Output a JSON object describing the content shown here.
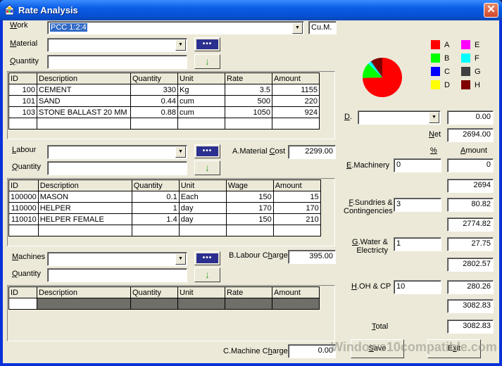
{
  "window": {
    "title": "Rate Analysis",
    "close_label": "✕"
  },
  "work": {
    "label_u": "W",
    "label_rest": "ork",
    "value": "PCC 1:2:4",
    "unit": "Cu.M."
  },
  "material": {
    "label_u": "M",
    "label_rest": "aterial",
    "value": "",
    "quantity_label_u": "Q",
    "quantity_label_rest": "uantity",
    "quantity_value": "",
    "browse_label": "•••",
    "add_icon": "↓",
    "columns": [
      "ID",
      "Description",
      "Quantity",
      "Unit",
      "Rate",
      "Amount"
    ],
    "rows": [
      [
        "100",
        "CEMENT",
        "330",
        "Kg",
        "3.5",
        "1155"
      ],
      [
        "101",
        "SAND",
        "0.44",
        "cum",
        "500",
        "220"
      ],
      [
        "103",
        "STONE BALLAST 20 MM",
        "0.88",
        "cum",
        "1050",
        "924"
      ]
    ]
  },
  "labour": {
    "label_u": "L",
    "label_rest": "abour",
    "value": "",
    "quantity_label_u": "Q",
    "quantity_label_rest": "uantity",
    "quantity_value": "",
    "browse_label": "•••",
    "add_icon": "↓",
    "columns": [
      "ID",
      "Description",
      "Quantity",
      "Unit",
      "Wage",
      "Amount"
    ],
    "rows": [
      [
        "100000",
        "MASON",
        "0.1",
        "Each",
        "150",
        "15"
      ],
      [
        "110000",
        "HELPER",
        "1",
        "day",
        "170",
        "170"
      ],
      [
        "110010",
        "HELPER FEMALE",
        "1.4",
        "day",
        "150",
        "210"
      ]
    ]
  },
  "machines": {
    "label_u": "M",
    "label_rest": "achines",
    "value": "",
    "quantity_label_u": "Q",
    "quantity_label_rest": "uantity",
    "quantity_value": "",
    "browse_label": "•••",
    "add_icon": "↓",
    "columns": [
      "ID",
      "Description",
      "Quantity",
      "Unit",
      "Rate",
      "Amount"
    ],
    "rows": []
  },
  "totals": {
    "material_cost_label_a": "A.Material ",
    "material_cost_label_u": "C",
    "material_cost_label_b": "ost",
    "material_cost": "2299.00",
    "labour_charge_label_a": "B.Labour C",
    "labour_charge_label_u": "h",
    "labour_charge_label_b": "arge",
    "labour_charge": "395.00",
    "machine_charge_label_a": "C.Machine C",
    "machine_charge_label_u": "h",
    "machine_charge_label_b": "arge",
    "machine_charge": "0.00"
  },
  "summary": {
    "d_label_u": "D",
    "d_label_rest": ".",
    "d_value": "",
    "d_amount": "0.00",
    "net_label_u": "N",
    "net_label_rest": "et",
    "net": "2694.00",
    "pct_header": "%",
    "amount_header_u": "A",
    "amount_header_rest": "mount",
    "machinery": {
      "label_u": "E",
      "label_rest": ".Machinery",
      "pct": "0",
      "amount": "0",
      "subtotal": "2694"
    },
    "sundries": {
      "label_u": "F",
      "label_rest": ".Sundries &",
      "label_line2": "Contingencies",
      "pct": "3",
      "amount": "80.82",
      "subtotal": "2774.82"
    },
    "water": {
      "label_u": "G",
      "label_rest": ".Water &",
      "label_line2": "Electricty",
      "pct": "1",
      "amount": "27.75",
      "subtotal": "2802.57"
    },
    "overhead": {
      "label_u": "H",
      "label_rest": ".OH & CP",
      "pct": "10",
      "amount": "280.26",
      "subtotal": "3082.83"
    },
    "total_label_u": "T",
    "total_label_rest": "otal",
    "total": "3082.83"
  },
  "buttons": {
    "save_u": "S",
    "save_rest": "ave",
    "exit_a": "E",
    "exit_u": "x",
    "exit_b": "it"
  },
  "legend": [
    {
      "key": "A",
      "color": "#ff0000"
    },
    {
      "key": "B",
      "color": "#00ff00"
    },
    {
      "key": "C",
      "color": "#0000ff"
    },
    {
      "key": "D",
      "color": "#ffff00"
    },
    {
      "key": "E",
      "color": "#ff00ff"
    },
    {
      "key": "F",
      "color": "#00ffff"
    },
    {
      "key": "G",
      "color": "#404040"
    },
    {
      "key": "H",
      "color": "#800000"
    }
  ],
  "chart_data": {
    "type": "pie",
    "title": "",
    "categories": [
      "A",
      "B",
      "C",
      "D",
      "E",
      "F",
      "G",
      "H"
    ],
    "values": [
      2299.0,
      395.0,
      0.0,
      0.0,
      0.0,
      80.82,
      27.75,
      280.26
    ],
    "colors": [
      "#ff0000",
      "#00ff00",
      "#0000ff",
      "#ffff00",
      "#ff00ff",
      "#00ffff",
      "#404040",
      "#800000"
    ],
    "legend": "right"
  },
  "watermark": "Windows10compatible.com"
}
